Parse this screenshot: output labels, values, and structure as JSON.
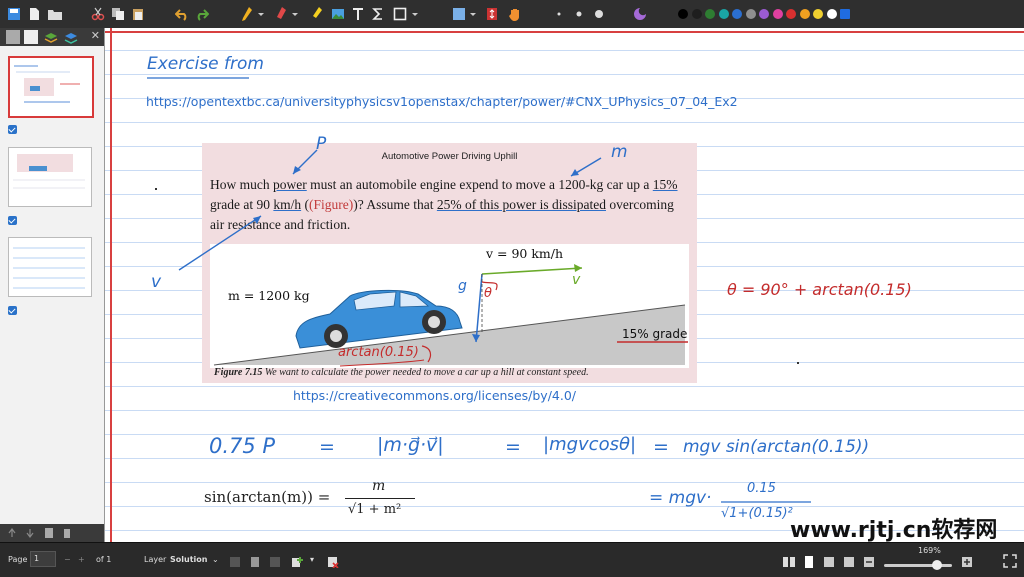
{
  "toolbar": {
    "palette": [
      "#000000",
      "#1e1e1e",
      "#2e7d32",
      "#1aa5a5",
      "#2b6fd1",
      "#8f8f8f",
      "#9b5bd3",
      "#e040a0",
      "#d83030",
      "#f0a020",
      "#f0d030",
      "#ffffff",
      "#1f6ce0"
    ]
  },
  "notes": {
    "heading": "Exercise from",
    "source_url": "https://opentextbc.ca/universityphysicsv1openstax/chapter/power/#CNX_UPhysics_07_04_Ex2",
    "license_url": "https://creativecommons.org/licenses/by/4.0/",
    "annotation_P": "P",
    "annotation_m": "m",
    "annotation_v": "v",
    "theta_eq": "θ = 90° + arctan(0.15)",
    "eq_lhs": "0.75 P",
    "eq_eq1": "=",
    "eq_mid": "|m·g⃗·v⃗|",
    "eq_eq2": "=",
    "eq_abs": "|mgvcosθ|",
    "eq_eq3": "=",
    "eq_rhs": "mgv sin(arctan(0.15))",
    "eq2_lhs": "= mgv·",
    "eq2_num": "0.15",
    "eq2_den": "√1+(0.15)²",
    "identity_lhs": "sin(arctan(m)) =",
    "identity_num": "m",
    "identity_den": "√1 + m²"
  },
  "book": {
    "title": "Automotive Power Driving Uphill",
    "text_pre": "How much ",
    "text_power": "power",
    "text_mid": " must an automobile engine expend to move a 1200-kg car up a ",
    "text_15": "15%",
    "text_grade": " grade at 90 ",
    "text_kmh": "km/h",
    "text_open": " (",
    "text_fig": "(Figure)",
    "text_close": ")? Assume that ",
    "text_25": "25% of this power is dissipated",
    "text_end": " overcoming air resistance and friction.",
    "fig_speed": "v = 90 km/h",
    "fig_mass": "m = 1200 kg",
    "fig_grade": "15% grade",
    "fig_g": "g",
    "fig_v": "v",
    "fig_theta": "θ",
    "fig_arctan": "arctan(0.15)",
    "caption_label": "Figure 7.15",
    "caption_text": " We want to calculate the power needed to move a car up a hill at constant speed."
  },
  "statusbar": {
    "page_label": "Page",
    "page_value": "1",
    "page_total": "of 1",
    "layer_label": "Layer",
    "layer_value": "Solution",
    "zoom": "169%"
  },
  "watermark": "www.rjtj.cn软荐网"
}
